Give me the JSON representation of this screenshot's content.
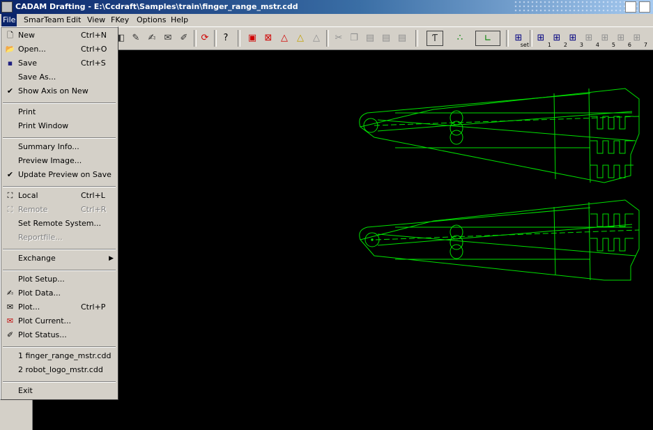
{
  "window": {
    "title": "CADAM Drafting - E:\\Ccdraft\\Samples\\train\\finger_range_mstr.cdd"
  },
  "menubar": {
    "file": "File",
    "smarteam": "SmarTeam",
    "edit": "Edit",
    "view": "View",
    "fkey": "FKey",
    "options": "Options",
    "help": "Help"
  },
  "toolbar": {
    "sublabels": {
      "set": "set",
      "b1": "1",
      "b2": "2",
      "b3": "3",
      "b4": "4",
      "b5": "5",
      "b6": "6",
      "b7": "7"
    }
  },
  "file_menu": {
    "new": {
      "label": "New",
      "shortcut": "Ctrl+N"
    },
    "open": {
      "label": "Open...",
      "shortcut": "Ctrl+O"
    },
    "save": {
      "label": "Save",
      "shortcut": "Ctrl+S"
    },
    "save_as": {
      "label": "Save As..."
    },
    "show_axis": {
      "label": "Show Axis on New",
      "checked": true
    },
    "print": {
      "label": "Print"
    },
    "print_window": {
      "label": "Print Window"
    },
    "summary_info": {
      "label": "Summary Info..."
    },
    "preview_image": {
      "label": "Preview Image..."
    },
    "update_preview": {
      "label": "Update Preview on Save",
      "checked": true
    },
    "local": {
      "label": "Local",
      "shortcut": "Ctrl+L"
    },
    "remote": {
      "label": "Remote",
      "shortcut": "Ctrl+R",
      "disabled": true
    },
    "set_remote": {
      "label": "Set Remote System..."
    },
    "reportfile": {
      "label": "Reportfile...",
      "disabled": true
    },
    "exchange": {
      "label": "Exchange"
    },
    "plot_setup": {
      "label": "Plot Setup..."
    },
    "plot_data": {
      "label": "Plot Data..."
    },
    "plot": {
      "label": "Plot...",
      "shortcut": "Ctrl+P"
    },
    "plot_current": {
      "label": "Plot Current..."
    },
    "plot_status": {
      "label": "Plot Status..."
    },
    "recent_1": {
      "label": "1 finger_range_mstr.cdd"
    },
    "recent_2": {
      "label": "2 robot_logo_mstr.cdd"
    },
    "exit": {
      "label": "Exit"
    }
  },
  "colors": {
    "drawing": "#00e000",
    "canvas": "#000000",
    "highlight": "#0a246a"
  }
}
